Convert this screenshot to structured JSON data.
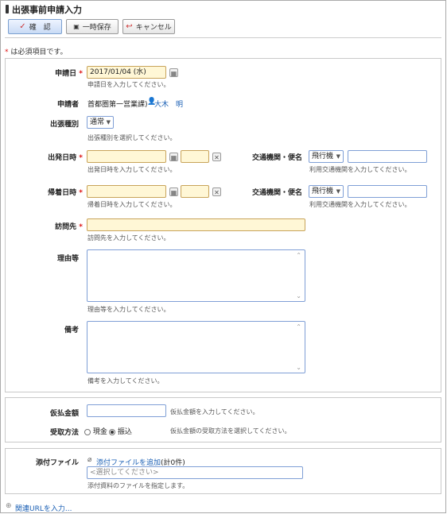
{
  "header": {
    "title": "出張事前申請入力"
  },
  "toolbar": {
    "confirm_label": "確　認",
    "save_label": "一時保存",
    "cancel_label": "キャンセル"
  },
  "required_note": "は必須項目です。",
  "form": {
    "apply_date": {
      "label": "申請日",
      "value": "2017/01/04 (水)",
      "hint": "申請日を入力してください。"
    },
    "applicant": {
      "label": "申請者",
      "dept": "首都圏第一営業課)",
      "name": "大木　明"
    },
    "trip_type": {
      "label": "出張種別",
      "value": "通常",
      "hint": "出張種別を選択してください。"
    },
    "depart": {
      "label": "出発日時",
      "hint": "出発日時を入力してください。",
      "transport_label": "交通機関・便名",
      "transport_value": "飛行機",
      "transport_hint": "利用交通機関を入力してください。"
    },
    "return": {
      "label": "帰着日時",
      "hint": "帰着日時を入力してください。",
      "transport_label": "交通機関・便名",
      "transport_value": "飛行機",
      "transport_hint": "利用交通機関を入力してください。"
    },
    "destination": {
      "label": "訪問先",
      "hint": "訪問先を入力してください。"
    },
    "reason": {
      "label": "理由等",
      "hint": "理由等を入力してください。"
    },
    "notes": {
      "label": "備考",
      "hint": "備考を入力してください。"
    }
  },
  "payment": {
    "advance": {
      "label": "仮払金額",
      "hint": "仮払金額を入力してください。"
    },
    "method": {
      "label": "受取方法",
      "option_cash": "現金",
      "option_transfer": "振込",
      "selected": "振込",
      "hint": "仮払金額の受取方法を選択してください。"
    }
  },
  "attachment": {
    "label": "添付ファイル",
    "add_link": "添付ファイルを追加",
    "count": "(計0件)",
    "placeholder": "<選択してください>",
    "hint": "添付資料のファイルを指定します。"
  },
  "related_url": {
    "label": "関連URLを入力..."
  },
  "icons": {
    "calendar": "calendar-icon",
    "clear": "clear-icon",
    "user": "user-icon",
    "clip": "paperclip-icon",
    "check": "check-icon",
    "save": "save-icon",
    "cancel": "undo-icon",
    "circle_plus": "circle-plus-icon"
  }
}
